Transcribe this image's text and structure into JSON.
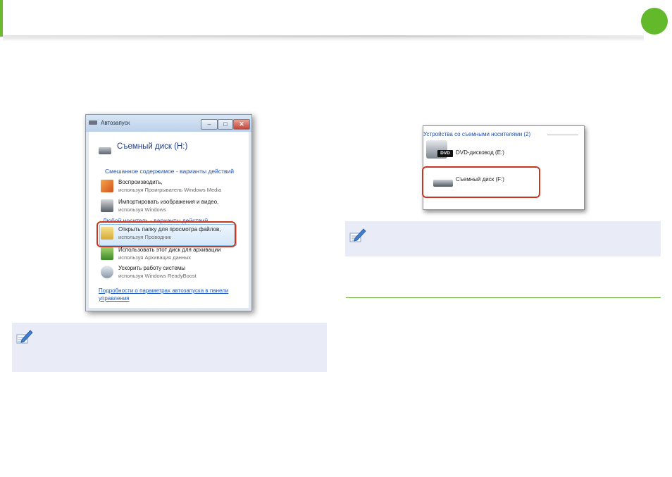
{
  "colors": {
    "accent": "#6dbb2c",
    "note_bg": "#e9ebf6",
    "highlight": "#c9361f",
    "link": "#1a55c6"
  },
  "autorun_dialog": {
    "title": "Автозапуск",
    "drive_name": "Съемный диск (H:)",
    "section_mixed": "Смешанное содержимое - варианты действий",
    "options": [
      {
        "icon": "media-player-icon",
        "title": "Воспроизводить,",
        "subtitle": "используя Проигрыватель Windows Media"
      },
      {
        "icon": "camera-icon",
        "title": "Импортировать изображения и видео,",
        "subtitle": "используя Windows"
      }
    ],
    "section_any": "Любой носитель - варианты действий",
    "options_any": [
      {
        "icon": "folder-icon",
        "title": "Открыть папку для просмотра файлов,",
        "subtitle": "используя Проводник"
      },
      {
        "icon": "backup-icon",
        "title": "Использовать этот диск для архивации",
        "subtitle": "используя Архивация данных"
      },
      {
        "icon": "readyboost-icon",
        "title": "Ускорить работу системы",
        "subtitle": "используя Windows ReadyBoost"
      }
    ],
    "link": "Подробности о параметрах автозапуска в панели управления"
  },
  "explorer_panel": {
    "section": "Устройства со съемными носителями (2)",
    "dvd_badge": "DVD",
    "items": [
      "DVD-дисковод (E:)",
      "Съемный диск (F:)"
    ]
  }
}
